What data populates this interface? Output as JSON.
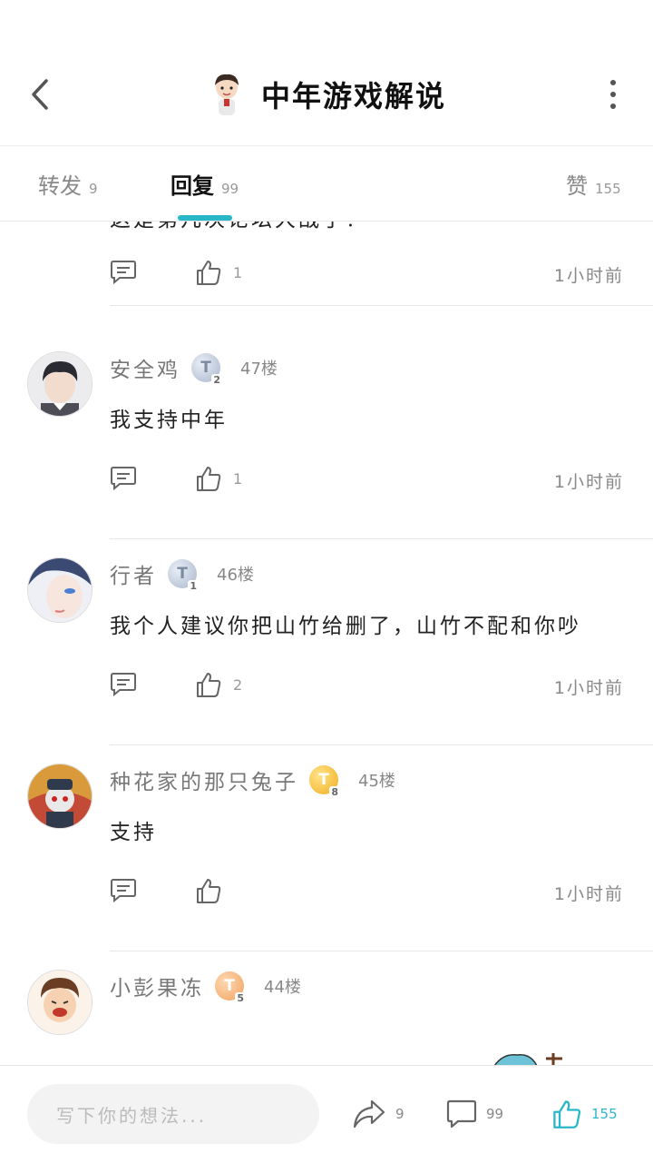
{
  "header": {
    "title": "中年游戏解说"
  },
  "tabs": [
    {
      "label": "转发",
      "count": "9"
    },
    {
      "label": "回复",
      "count": "99"
    },
    {
      "label": "赞",
      "count": "155"
    }
  ],
  "partial_comment": {
    "content": "这是第几次论坛大战了？",
    "likes": "1",
    "time": "1小时前"
  },
  "comments": [
    {
      "username": "安全鸡",
      "badge_letter": "T",
      "badge_level": "2",
      "floor": "47楼",
      "content": "我支持中年",
      "likes": "1",
      "time": "1小时前"
    },
    {
      "username": "行者",
      "badge_letter": "T",
      "badge_level": "1",
      "floor": "46楼",
      "content": "我个人建议你把山竹给删了，山竹不配和你吵",
      "likes": "2",
      "time": "1小时前"
    },
    {
      "username": "种花家的那只兔子",
      "badge_letter": "T",
      "badge_level": "8",
      "floor": "45楼",
      "content": "支持",
      "likes": "",
      "time": "1小时前"
    },
    {
      "username": "小彭果冻",
      "badge_letter": "T",
      "badge_level": "5",
      "floor": "44楼",
      "content": "",
      "likes": "",
      "time": ""
    }
  ],
  "bottom_bar": {
    "input_placeholder": "写下你的想法...",
    "share_count": "9",
    "comment_count": "99",
    "like_count": "155"
  },
  "colors": {
    "accent": "#29b6c6",
    "muted": "#888888"
  }
}
